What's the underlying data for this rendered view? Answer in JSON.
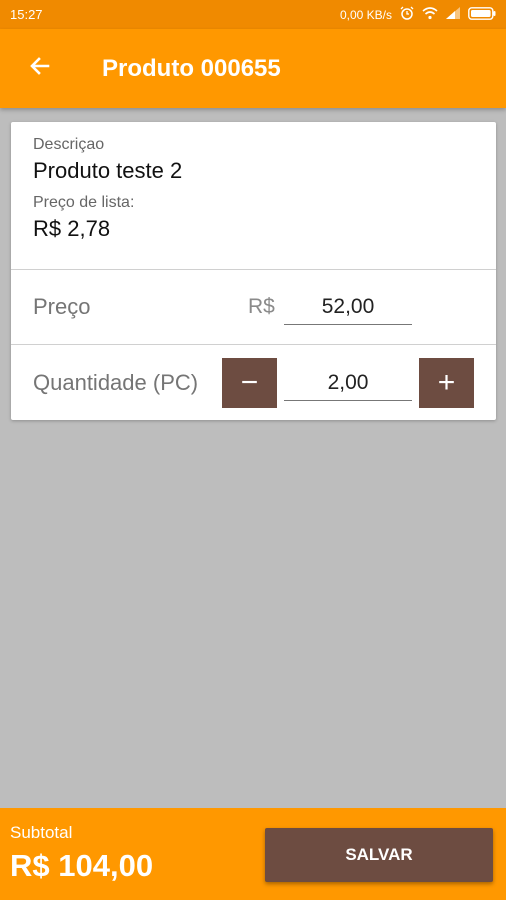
{
  "status_bar": {
    "time": "15:27",
    "network_speed": "0,00 KB/s",
    "icons": [
      "alarm-icon",
      "wifi-icon",
      "signal-icon",
      "battery-icon"
    ]
  },
  "toolbar": {
    "back_icon": "arrow-left-icon",
    "title": "Produto 000655"
  },
  "product": {
    "description_label": "Descriçao",
    "description_value": "Produto teste 2",
    "list_price_label": "Preço de lista:",
    "list_price_value": "R$ 2,78"
  },
  "price_row": {
    "label": "Preço",
    "currency": "R$",
    "value": "52,00"
  },
  "quantity_row": {
    "label": "Quantidade (PC)",
    "decrement": "−",
    "value": "2,00",
    "increment": "+"
  },
  "footer": {
    "subtotal_label": "Subtotal",
    "subtotal_value": "R$ 104,00",
    "save_label": "SALVAR"
  },
  "colors": {
    "primary": "#ff9800",
    "status_bar": "#f08a00",
    "accent_brown": "#6d4c41",
    "background": "#bdbdbd"
  }
}
